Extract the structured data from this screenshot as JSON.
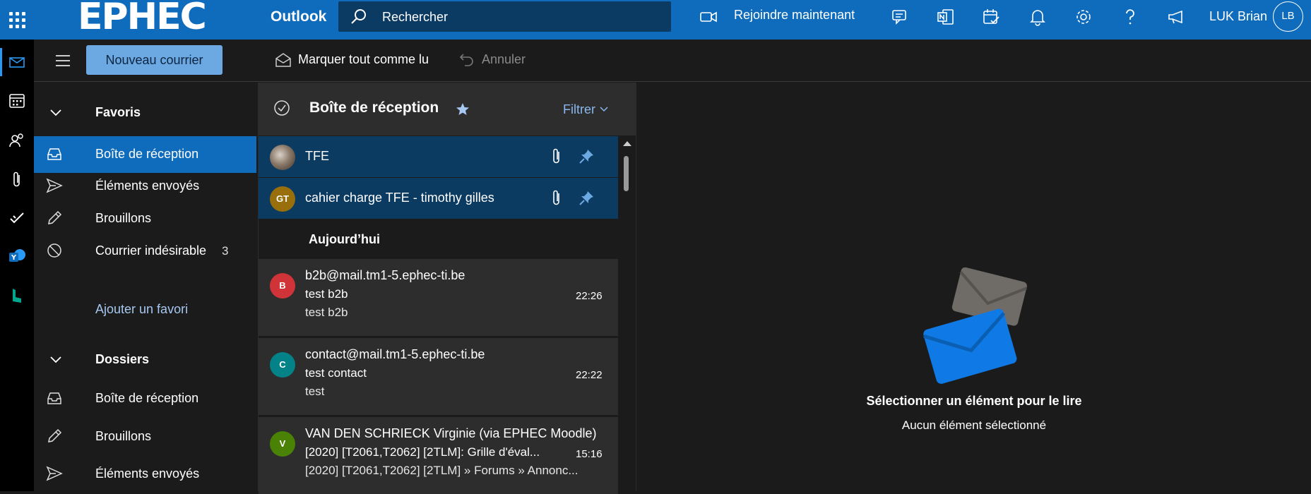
{
  "topbar": {
    "logo": "EPHEC",
    "app_name": "Outlook",
    "search_placeholder": "Rechercher",
    "join_label": "Rejoindre maintenant",
    "user_name": "LUK Brian",
    "avatar_initials": "LB",
    "icons": [
      "app-launcher-icon",
      "video-icon",
      "chat-icon",
      "onenote-icon",
      "calendar-check-icon",
      "bell-icon",
      "gear-icon",
      "help-icon",
      "megaphone-icon"
    ]
  },
  "rail": {
    "icons": [
      "mail-icon",
      "calendar-icon",
      "people-icon",
      "paperclip-icon",
      "todo-icon",
      "yammer-icon",
      "bookings-icon"
    ]
  },
  "commands": {
    "new_mail": "Nouveau courrier",
    "mark_all_read": "Marquer tout comme lu",
    "undo": "Annuler"
  },
  "nav": {
    "favorites_header": "Favoris",
    "favorites": [
      {
        "label": "Boîte de réception",
        "icon": "inbox-icon",
        "selected": true
      },
      {
        "label": "Éléments envoyés",
        "icon": "send-icon"
      },
      {
        "label": "Brouillons",
        "icon": "pencil-icon"
      },
      {
        "label": "Courrier indésirable",
        "icon": "blocked-icon",
        "count": "3"
      }
    ],
    "add_favorite": "Ajouter un favori",
    "folders_header": "Dossiers",
    "folders": [
      {
        "label": "Boîte de réception",
        "icon": "inbox-icon"
      },
      {
        "label": "Brouillons",
        "icon": "pencil-icon"
      },
      {
        "label": "Éléments envoyés",
        "icon": "send-icon"
      }
    ]
  },
  "list": {
    "title": "Boîte de réception",
    "filter": "Filtrer",
    "pinned": [
      {
        "title": "TFE",
        "avatar": "",
        "avatar_color": "#6b5a4a"
      },
      {
        "title": "cahier charge TFE - timothy gilles",
        "avatar": "GT",
        "avatar_color": "#986f0b"
      }
    ],
    "group_today": "Aujourd’hui",
    "messages": [
      {
        "avatar": "B",
        "avatar_color": "#d13438",
        "from": "b2b@mail.tm1-5.ephec-ti.be",
        "subject": "test b2b",
        "preview": "test b2b",
        "time": "22:26"
      },
      {
        "avatar": "C",
        "avatar_color": "#038387",
        "from": "contact@mail.tm1-5.ephec-ti.be",
        "subject": "test contact",
        "preview": "test",
        "time": "22:22"
      },
      {
        "avatar": "V",
        "avatar_color": "#498205",
        "from": "VAN DEN SCHRIECK Virginie (via EPHEC Moodle)",
        "subject": "[2020] [T2061,T2062] [2TLM]: Grille d'éval...",
        "preview": "[2020] [T2061,T2062] [2TLM] » Forums » Annonc...",
        "time": "15:16"
      }
    ]
  },
  "reading": {
    "title": "Sélectionner un élément pour le lire",
    "subtitle": "Aucun élément sélectionné"
  },
  "colors": {
    "accent": "#0f6cbd",
    "selected_row": "#0c3b62",
    "background": "#1b1b1b"
  }
}
